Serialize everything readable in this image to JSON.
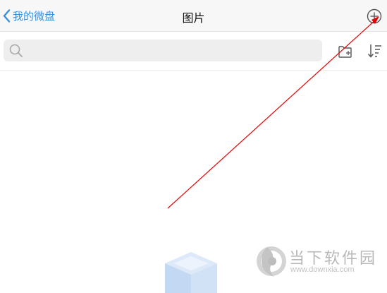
{
  "navbar": {
    "back_label": "我的微盘",
    "title": "图片",
    "add_icon": "plus-circle-icon"
  },
  "search": {
    "placeholder": "",
    "value": ""
  },
  "toolbar": {
    "new_folder_icon": "folder-plus-icon",
    "sort_icon": "sort-icon"
  },
  "empty_state": {
    "icon": "empty-box-icon"
  },
  "watermark": {
    "title": "当下软件园",
    "url": "www.downxia.com"
  },
  "colors": {
    "accent": "#3a8fd8",
    "annotation": "#e60000",
    "navbar_bg": "#f7f7f7",
    "search_bg": "#eeeeee"
  }
}
